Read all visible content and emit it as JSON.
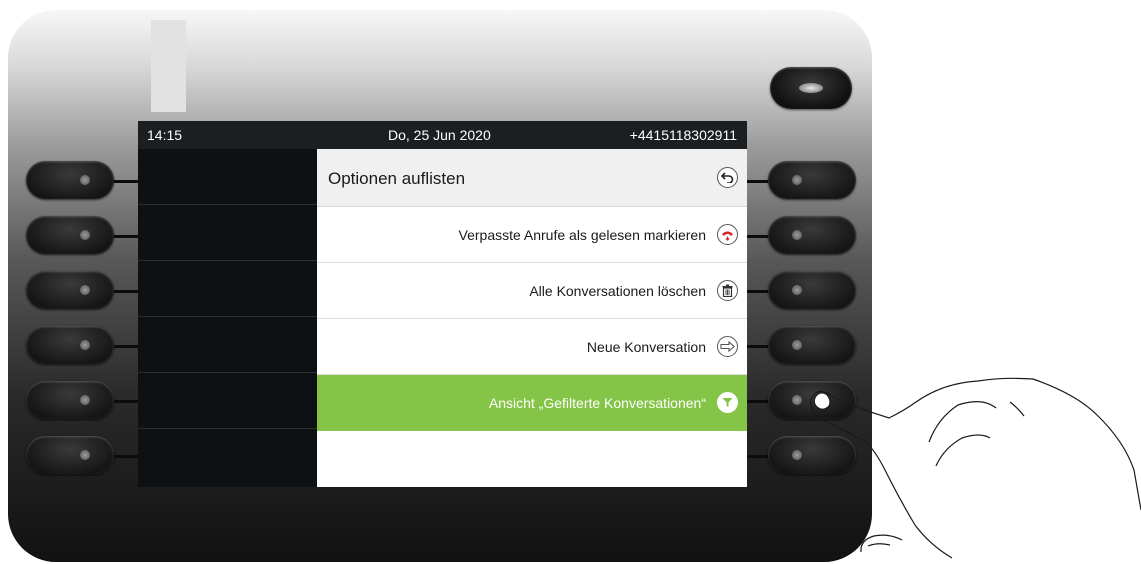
{
  "statusbar": {
    "time": "14:15",
    "date": "Do, 25 Jun 2020",
    "number": "+4415118302911"
  },
  "header": {
    "title": "Optionen auflisten",
    "icon": "back-arrow-icon"
  },
  "options": [
    {
      "label": "Verpasste Anrufe als gelesen markieren",
      "icon": "missed-call-icon",
      "selected": false
    },
    {
      "label": "Alle Konversationen löschen",
      "icon": "trash-icon",
      "selected": false
    },
    {
      "label": "Neue Konversation",
      "icon": "arrow-right-icon",
      "selected": false
    },
    {
      "label": "Ansicht „Gefilterte Konversationen“",
      "icon": "filter-icon",
      "selected": true
    }
  ],
  "colors": {
    "selected_row": "#84c446",
    "missed_call_icon": "#d9262c"
  }
}
